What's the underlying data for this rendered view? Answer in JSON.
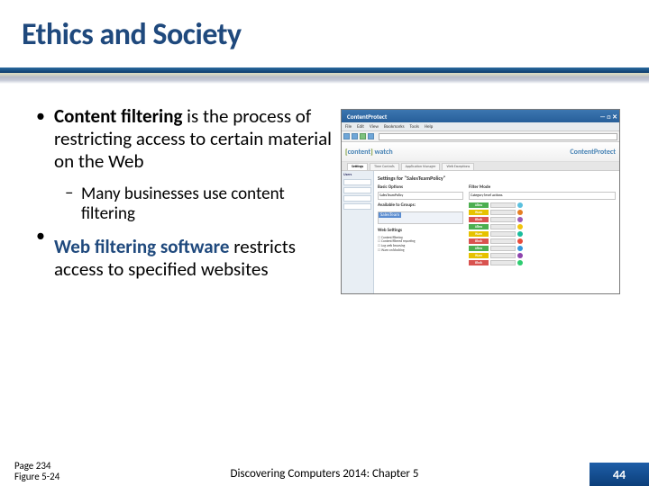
{
  "title": "Ethics and Society",
  "bullets": {
    "first_bold": "Content filtering",
    "first_rest": " is the process of restricting access to certain material on the Web",
    "sub1": "Many businesses use content filtering",
    "second_bold": "Web filtering software",
    "second_rest": " restricts access to specified websites"
  },
  "footer": {
    "page_ref": "Page 234",
    "figure_ref": "Figure 5-24",
    "center": "Discovering Computers 2014: Chapter 5",
    "slide_no": "44"
  },
  "app": {
    "window_title": "ContentProtect",
    "menus": [
      "File",
      "Edit",
      "View",
      "Bookmarks",
      "Tools",
      "Help"
    ],
    "brand_left": "content",
    "brand_left2": "watch",
    "brand_right": "ContentProtect",
    "tabs": [
      "Settings",
      "Time Controls",
      "Application Manager",
      "Web Exceptions"
    ],
    "leftpane_label": "Users",
    "panel_title": "Settings for \"SalesTeamPolicy\"",
    "col_left_h1": "Basic Options",
    "policy_name": "SalesTeamPolicy",
    "col_left_h2": "Available to Groups:",
    "scope_selected": "SalesTeam",
    "checklist_h": "Web Settings",
    "checks": [
      "Content filtering",
      "Content filtered reporting",
      "Log web browsing",
      "Warn on blocking"
    ],
    "col_right_h": "Filter Mode",
    "filter_desc": "Category level actions",
    "badges": [
      "Allow",
      "Warn",
      "Block",
      "Allow",
      "Warn",
      "Block",
      "Allow",
      "Warn",
      "Block"
    ],
    "badge_classes": [
      "b-green",
      "b-yellow",
      "b-red",
      "b-green",
      "b-yellow",
      "b-red",
      "b-green",
      "b-yellow",
      "b-red"
    ]
  }
}
